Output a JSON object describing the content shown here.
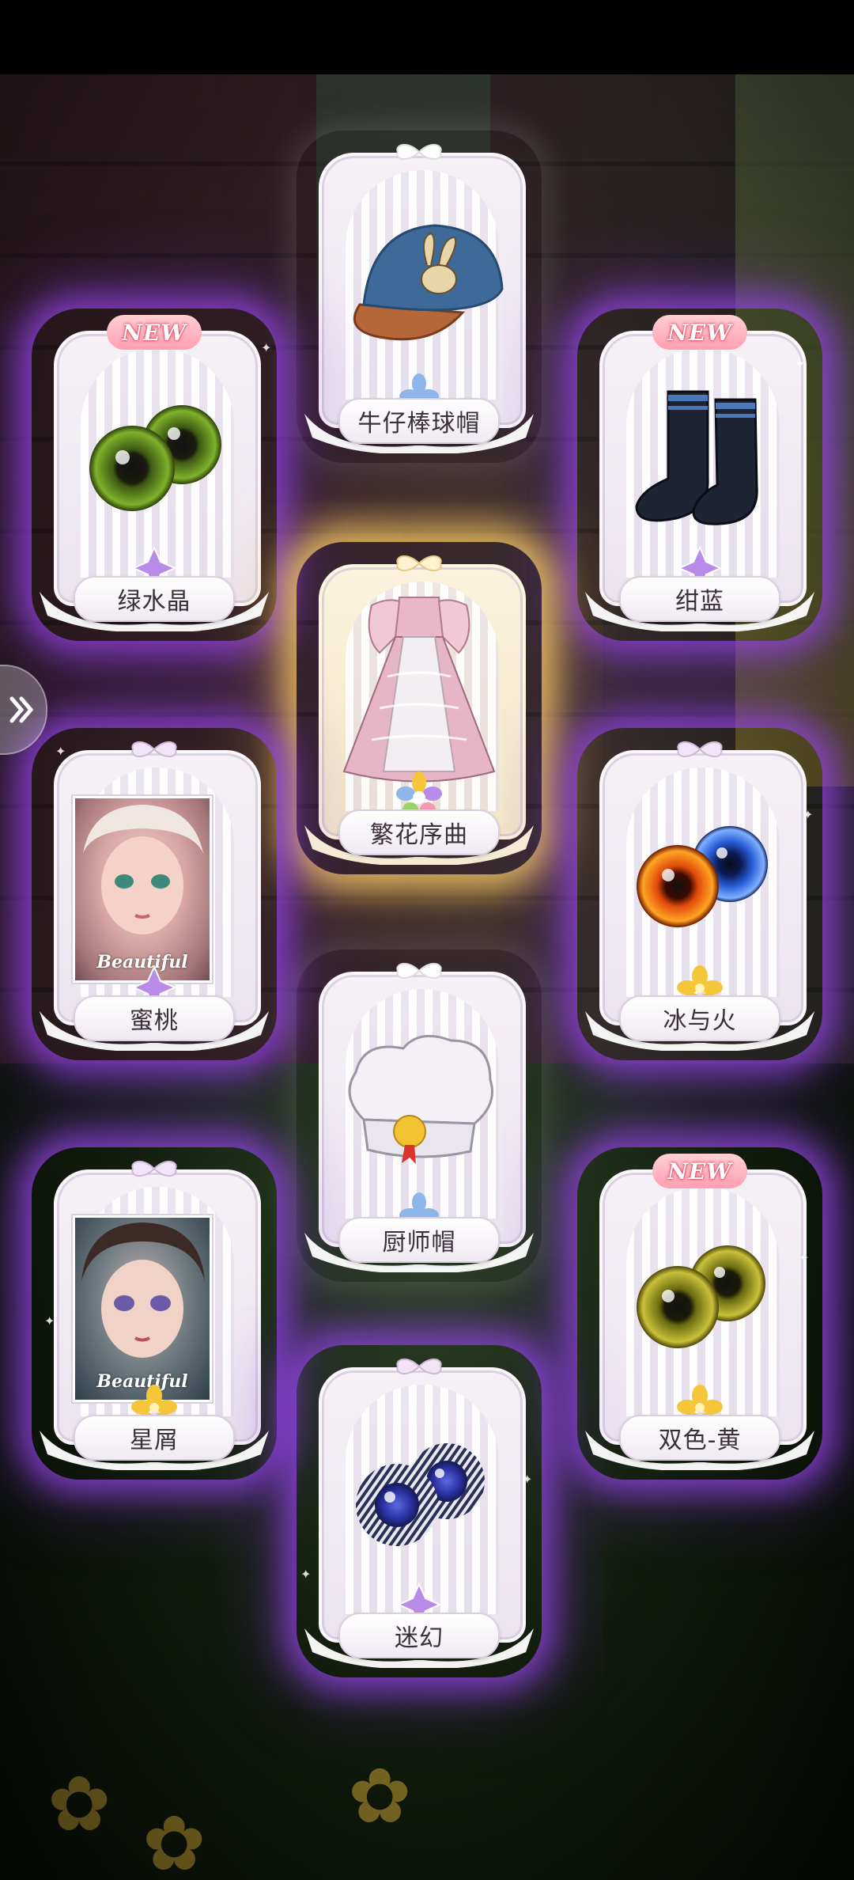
{
  "colors": {
    "purple_glow": "#9646e6",
    "gold_glow": "#ffd26e",
    "new_badge": "#ff9fb0",
    "rarity_purple": "#b98be8",
    "rarity_gold": "#f5c63a",
    "rarity_blue": "#8fb6ea"
  },
  "rewards": [
    {
      "id": "denim-cap",
      "name": "牛仔棒球帽",
      "new": false,
      "rarity": "blue",
      "icon": "cap-icon"
    },
    {
      "id": "green-crystal",
      "name": "绿水晶",
      "new": true,
      "badge": "NEW",
      "rarity": "purple",
      "icon": "green-eyes-icon"
    },
    {
      "id": "navy",
      "name": "绀蓝",
      "new": true,
      "badge": "NEW",
      "rarity": "purple",
      "icon": "socks-icon"
    },
    {
      "id": "flower-prelude",
      "name": "繁花序曲",
      "new": false,
      "rarity": "gold",
      "icon": "dress-icon"
    },
    {
      "id": "peach",
      "name": "蜜桃",
      "new": false,
      "rarity": "purple",
      "icon": "portrait-icon",
      "portrait_text": "Beautiful"
    },
    {
      "id": "ice-and-fire",
      "name": "冰与火",
      "new": false,
      "rarity": "gold",
      "icon": "fire-ice-eyes-icon"
    },
    {
      "id": "chef-hat",
      "name": "厨师帽",
      "new": false,
      "rarity": "blue",
      "icon": "chef-hat-icon"
    },
    {
      "id": "stardust",
      "name": "星屑",
      "new": false,
      "rarity": "gold",
      "icon": "portrait-icon",
      "portrait_text": "Beautiful"
    },
    {
      "id": "bicolor-yellow",
      "name": "双色-黄",
      "new": true,
      "badge": "NEW",
      "rarity": "gold",
      "icon": "yellow-eyes-icon"
    },
    {
      "id": "illusion",
      "name": "迷幻",
      "new": false,
      "rarity": "purple",
      "icon": "blue-eyes-icon"
    }
  ],
  "side_button": {
    "icon": "double-chevron-right-icon"
  }
}
